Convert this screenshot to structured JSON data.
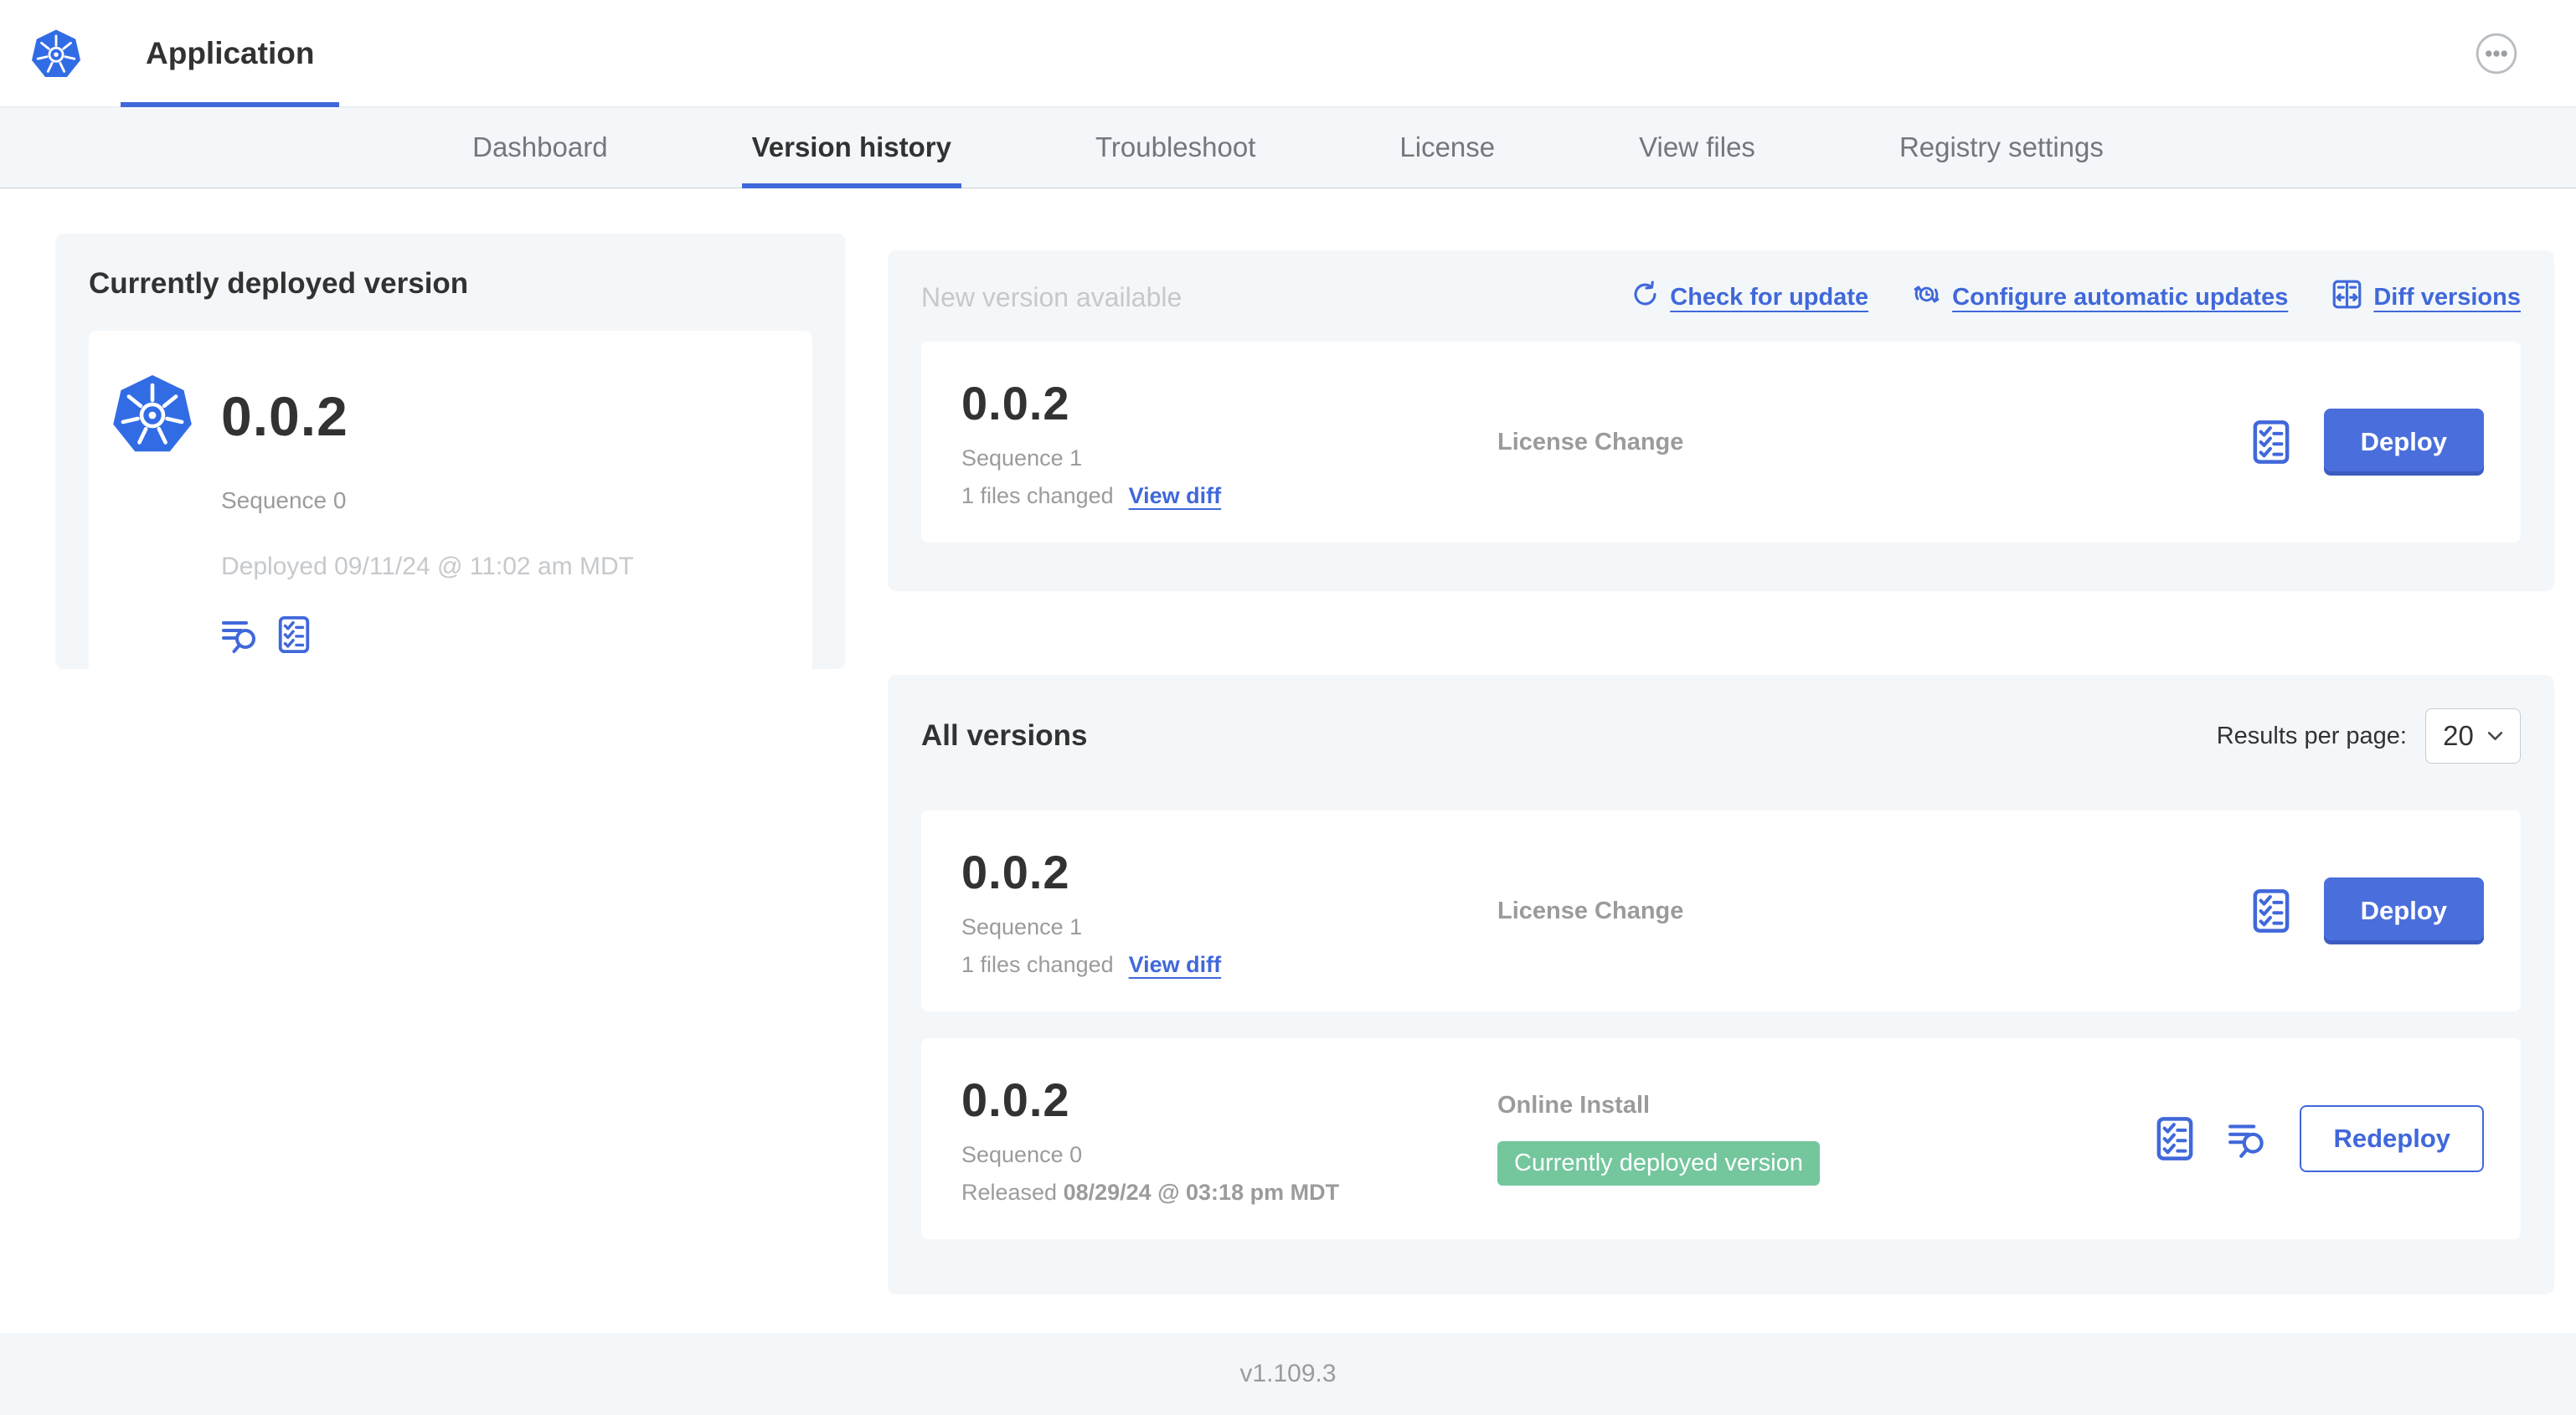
{
  "colors": {
    "accent_blue": "#4068da",
    "button_blue": "#4a6edb",
    "kubernetes_blue": "#326ce5",
    "badge_green": "#74c69d",
    "heading_text": "#323232",
    "muted_text": "#9b9b9b",
    "faint_text": "#c6c9cc",
    "panel_background": "#f4f7f9"
  },
  "icons": {
    "brand": "kubernetes-wheel-logo",
    "header_right": "more-ellipsis-icon",
    "check_link": "refresh-icon",
    "configure_link": "clock-sync-icon",
    "diff_link": "diff-columns-icon",
    "version_actions": [
      "preflight-checklist-icon",
      "release-notes-search-icon"
    ],
    "select": "chevron-down-icon"
  },
  "header": {
    "app_title": "Application"
  },
  "nav": {
    "tabs": [
      {
        "label": "Dashboard"
      },
      {
        "label": "Version history",
        "active": true
      },
      {
        "label": "Troubleshoot"
      },
      {
        "label": "License"
      },
      {
        "label": "View files"
      },
      {
        "label": "Registry settings"
      }
    ]
  },
  "current_version": {
    "heading": "Currently deployed version",
    "version": "0.0.2",
    "sequence": "Sequence 0",
    "deployed": "Deployed 09/11/24 @ 11:02 am MDT"
  },
  "new_version": {
    "heading": "New version available",
    "check_for_update": "Check for update",
    "configure_automatic_updates": "Configure automatic updates",
    "diff_versions": "Diff versions",
    "card": {
      "version": "0.0.2",
      "sequence": "Sequence 1",
      "files_changed": "1 files changed",
      "view_diff": "View diff",
      "source": "License Change",
      "deploy": "Deploy"
    }
  },
  "all_versions": {
    "heading": "All versions",
    "results_per_page_label": "Results per page:",
    "page_size": "20",
    "rows": [
      {
        "version": "0.0.2",
        "sequence": "Sequence 1",
        "files_changed": "1 files changed",
        "view_diff": "View diff",
        "source": "License Change",
        "action": "Deploy"
      },
      {
        "version": "0.0.2",
        "sequence": "Sequence 0",
        "released_prefix": "Released ",
        "released_date": "08/29/24 @ 03:18 pm MDT",
        "source": "Online Install",
        "badge": "Currently deployed version",
        "action": "Redeploy"
      }
    ]
  },
  "footer": {
    "version": "v1.109.3"
  }
}
